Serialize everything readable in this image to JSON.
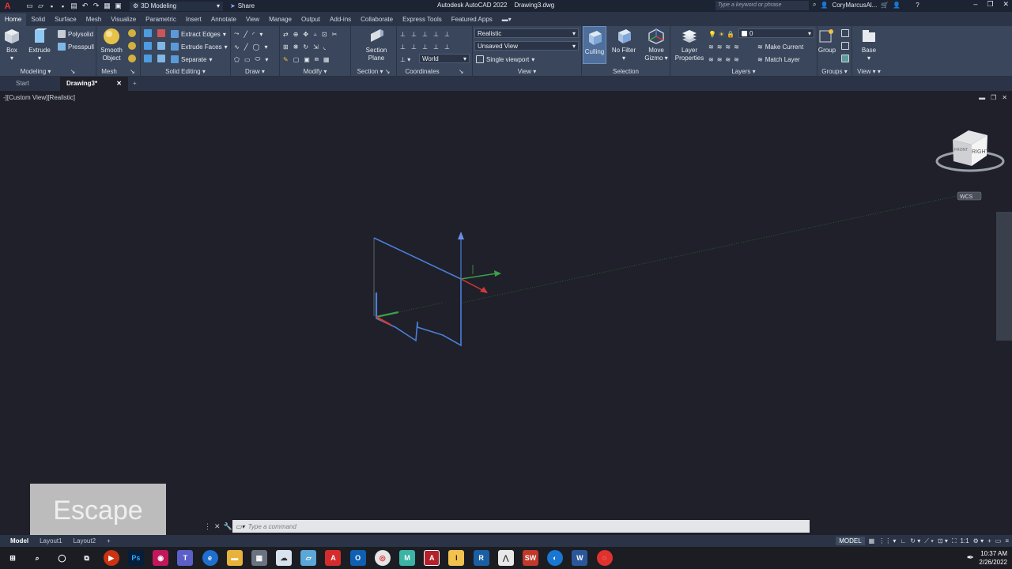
{
  "titlebar": {
    "workspace": "3D Modeling",
    "share": "Share",
    "app_title": "Autodesk AutoCAD 2022",
    "file": "Drawing3.dwg",
    "search_placeholder": "Type a keyword or phrase",
    "user": "CoryMarcusAl..."
  },
  "tabs": [
    "Home",
    "Solid",
    "Surface",
    "Mesh",
    "Visualize",
    "Parametric",
    "Insert",
    "Annotate",
    "View",
    "Manage",
    "Output",
    "Add-ins",
    "Collaborate",
    "Express Tools",
    "Featured Apps"
  ],
  "ribbon": {
    "modeling": {
      "title": "Modeling",
      "box": "Box",
      "extrude": "Extrude",
      "polysolid": "Polysolid",
      "presspull": "Presspull"
    },
    "mesh": {
      "title": "Mesh",
      "smooth": "Smooth",
      "object": "Object"
    },
    "solid_editing": {
      "title": "Solid Editing",
      "extract_edges": "Extract Edges",
      "extrude_faces": "Extrude Faces",
      "separate": "Separate"
    },
    "draw": {
      "title": "Draw"
    },
    "modify": {
      "title": "Modify"
    },
    "section": {
      "title": "Section",
      "section": "Section",
      "plane": "Plane"
    },
    "coordinates": {
      "title": "Coordinates",
      "world": "World"
    },
    "view": {
      "title": "View",
      "visual_style": "Realistic",
      "named_view": "Unsaved View",
      "viewport": "Single viewport"
    },
    "selection": {
      "title": "Selection",
      "culling": "Culling",
      "no_filter": "No Filter",
      "move": "Move",
      "gizmo": "Gizmo"
    },
    "layers": {
      "title": "Layers",
      "layer": "Layer",
      "properties": "Properties",
      "current_layer": "0",
      "make_current": "Make Current",
      "match_layer": "Match Layer"
    },
    "groups": {
      "title": "Groups",
      "group": "Group"
    },
    "view2": {
      "title": "View",
      "base": "Base"
    }
  },
  "doctabs": {
    "start": "Start",
    "drawing": "Drawing3*"
  },
  "viewport": {
    "label": "-][Custom View][Realistic]",
    "viewcube_face": "RIGHT",
    "viewcube_side": "FRONT",
    "wcs": "WCS",
    "overlay_key": "Escape"
  },
  "command": {
    "placeholder": "Type a command"
  },
  "status": {
    "layouts": [
      "Model",
      "Layout1",
      "Layout2"
    ],
    "model": "MODEL",
    "scale": "1:1"
  },
  "taskbar": {
    "time": "10:37 AM",
    "date": "2/26/2022"
  },
  "colors": {
    "accent": "#3a465b",
    "ucs_blue": "#4a7fd8",
    "axis_green": "#3aa04a",
    "axis_red": "#d23a3a"
  }
}
